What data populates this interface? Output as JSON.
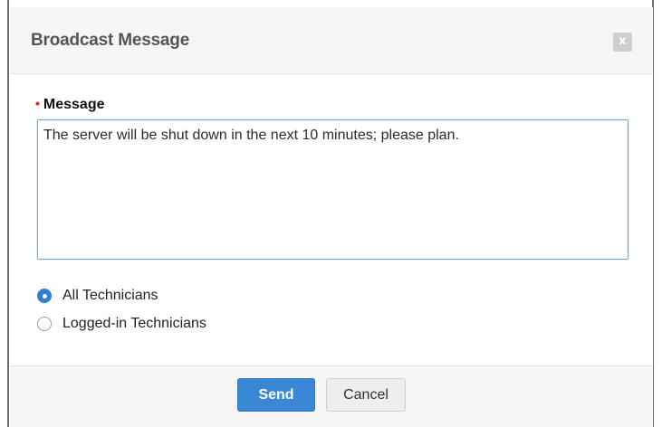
{
  "dialog": {
    "title": "Broadcast Message",
    "close_label": "x"
  },
  "form": {
    "required_marker": "•",
    "message_label": "Message",
    "message_value": "The server will be shut down in the next 10 minutes; please plan.",
    "recipients": [
      {
        "label": "All Technicians",
        "selected": true
      },
      {
        "label": "Logged-in Technicians",
        "selected": false
      }
    ]
  },
  "footer": {
    "send_label": "Send",
    "cancel_label": "Cancel"
  },
  "colors": {
    "accent": "#3a87d6",
    "required": "#e02424",
    "focus_border": "#6fa4d8"
  }
}
